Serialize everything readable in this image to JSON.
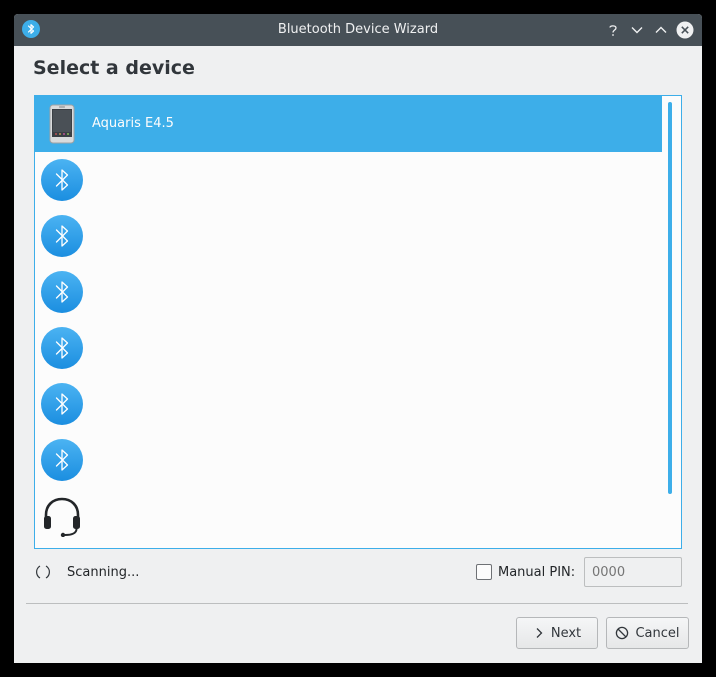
{
  "window": {
    "title": "Bluetooth Device Wizard",
    "titlebar_icons": [
      "bluetooth-icon",
      "help-icon",
      "minimize-icon",
      "maximize-icon",
      "close-icon"
    ]
  },
  "heading": "Select a device",
  "devices": [
    {
      "name": "Aquaris E4.5",
      "icon": "phone-icon",
      "selected": true
    },
    {
      "name": "",
      "icon": "bluetooth-icon",
      "selected": false
    },
    {
      "name": "",
      "icon": "bluetooth-icon",
      "selected": false
    },
    {
      "name": "",
      "icon": "bluetooth-icon",
      "selected": false
    },
    {
      "name": "",
      "icon": "bluetooth-icon",
      "selected": false
    },
    {
      "name": "",
      "icon": "bluetooth-icon",
      "selected": false
    },
    {
      "name": "",
      "icon": "bluetooth-icon",
      "selected": false
    },
    {
      "name": "",
      "icon": "headset-icon",
      "selected": false
    }
  ],
  "status": {
    "text": "Scanning...",
    "icon": "spinner-icon"
  },
  "manual_pin": {
    "label": "Manual PIN:",
    "checked": false,
    "placeholder": "0000",
    "value": ""
  },
  "buttons": {
    "next": "Next",
    "cancel": "Cancel"
  },
  "colors": {
    "titlebar": "#475057",
    "accent": "#3daee9",
    "background": "#eff0f1"
  }
}
